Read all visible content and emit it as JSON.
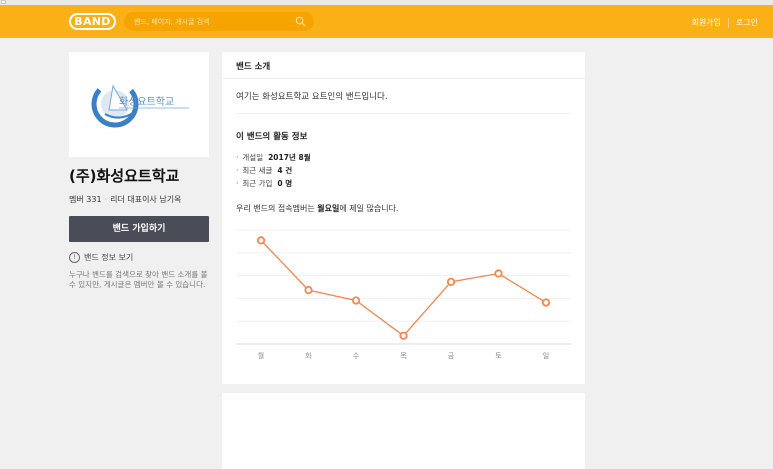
{
  "header": {
    "logo_text": "BAND",
    "search_placeholder": "밴드, 페이지, 게시글 검색",
    "signup_label": "회원가입",
    "login_label": "로그인"
  },
  "profile": {
    "cover_logo_text": "화성요트학교",
    "name": "(주)화성요트학교",
    "member_label": "멤버 331",
    "leader_label": "리더 대표이사 남기옥",
    "join_button_label": "밴드 가입하기",
    "info_link_label": "밴드 정보 보기",
    "info_description": "누구나 밴드를 검색으로 찾아 밴드 소개를 볼 수 있지만, 게시글은 멤버만 볼 수 있습니다."
  },
  "card": {
    "title": "밴드 소개",
    "intro": "여기는 화성요트학교 요트인의 밴드입니다.",
    "activity_title": "이 밴드의 활동 정보",
    "stats": [
      {
        "label": "개설일",
        "value": "2017년 8월"
      },
      {
        "label": "최근 새글",
        "value": "4 건"
      },
      {
        "label": "최근 가입",
        "value": "0 명"
      }
    ],
    "summary_prefix": "우리 밴드의 접속멤버는 ",
    "summary_bold": "월요일",
    "summary_suffix": "에 제일 많습니다."
  },
  "chart_data": {
    "type": "line",
    "categories": [
      "월",
      "화",
      "수",
      "목",
      "금",
      "토",
      "일"
    ],
    "values": [
      5.0,
      2.6,
      2.1,
      0.4,
      3.0,
      3.4,
      2.0
    ],
    "ylim": [
      0,
      5.5
    ],
    "color": "#f4864f",
    "grid": true
  },
  "colors": {
    "header_bg": "#fbb016",
    "join_button_bg": "#4a4d57",
    "line": "#f4864f"
  }
}
